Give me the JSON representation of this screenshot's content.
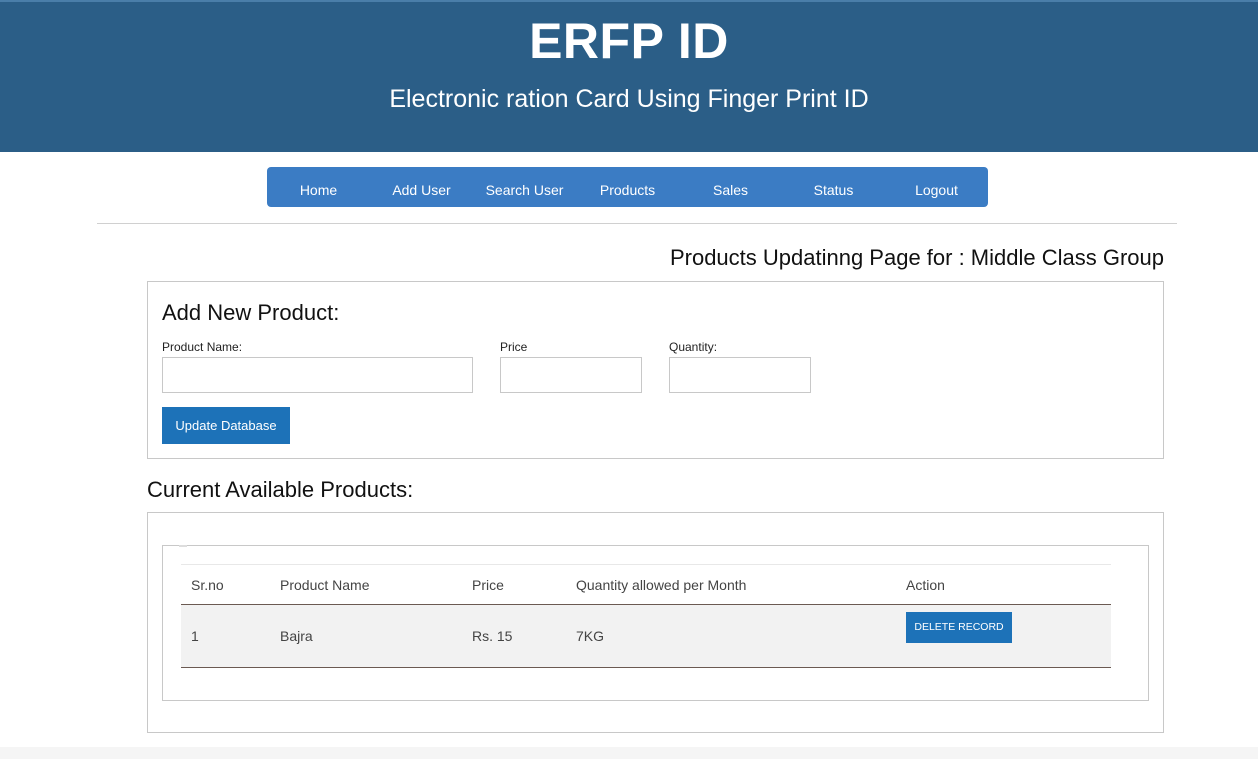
{
  "header": {
    "title": "ERFP ID",
    "subtitle": "Electronic ration Card Using Finger Print ID"
  },
  "nav": {
    "items": [
      "Home",
      "Add User",
      "Search User",
      "Products",
      "Sales",
      "Status",
      "Logout"
    ]
  },
  "page_heading": "Products Updatinng Page for : Middle Class Group",
  "add_product": {
    "heading": "Add New Product:",
    "product_name_label": "Product Name:",
    "price_label": "Price",
    "quantity_label": "Quantity:",
    "product_name_value": "",
    "price_value": "",
    "quantity_value": "",
    "submit_label": "Update Database"
  },
  "products": {
    "heading": "Current Available Products:",
    "columns": [
      "Sr.no",
      "Product Name",
      "Price",
      "Quantity allowed per Month",
      "Action"
    ],
    "rows": [
      {
        "srno": "1",
        "name": "Bajra",
        "price": "Rs. 15",
        "quantity": "7KG",
        "action": "DELETE RECORD"
      }
    ]
  },
  "colors": {
    "header_bg": "#2b5e87",
    "nav_bg": "#3b7cc4",
    "button_bg": "#1d72b8"
  }
}
